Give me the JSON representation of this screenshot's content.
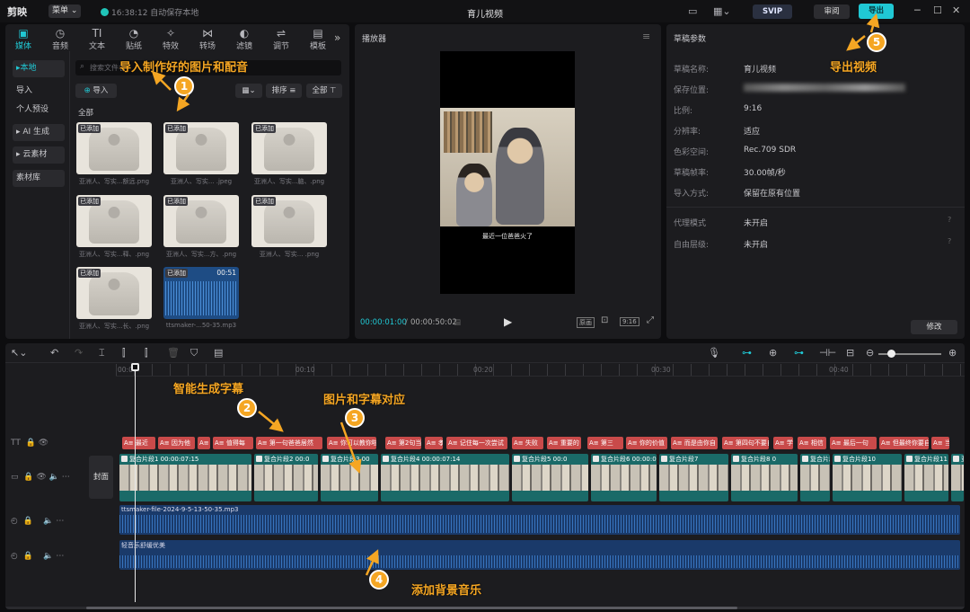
{
  "topbar": {
    "logo": "剪映",
    "menu": "菜单 ⌄",
    "save_status": "16:38:12 自动保存本地",
    "project_title": "育儿视频",
    "svip": "SVIP",
    "review": "审阅",
    "export": "导出"
  },
  "library": {
    "tools": [
      "媒体",
      "音频",
      "文本",
      "贴纸",
      "特效",
      "转场",
      "滤镜",
      "调节",
      "模板"
    ],
    "tool_glyphs": [
      "▣",
      "◷",
      "TI",
      "◔",
      "✧",
      "⋈",
      "◐",
      "⇌",
      "▤"
    ],
    "sidebar": [
      "▸本地",
      "导入",
      "个人预设",
      "▸ AI 生成",
      "▸ 云素材",
      "素材库"
    ],
    "search_placeholder": "搜索文件名",
    "import_btn": "导入",
    "sort_btn": "排序",
    "all_btn": "全部",
    "section": "全部",
    "added_badge": "已添加",
    "items": [
      {
        "caption": "亚洲人、写实...额远.png"
      },
      {
        "caption": "亚洲人、写实...  .jpeg"
      },
      {
        "caption": "亚洲人、写实...脑、.png"
      },
      {
        "caption": "亚洲人、写实...释、.png"
      },
      {
        "caption": "亚洲人、写实...方、.png"
      },
      {
        "caption": "亚洲人、写实...  .png"
      },
      {
        "caption": "亚洲人、写实...长、.png"
      },
      {
        "caption": "ttsmaker-...50-35.mp3",
        "duration": "00:51"
      }
    ]
  },
  "player": {
    "header": "播放器",
    "subtitle": "最近一位爸爸火了",
    "current_time": "00:00:01:00",
    "total_time": "00:00:50:02",
    "original": "原画",
    "ratio": "9:16"
  },
  "params": {
    "header": "草稿参数",
    "rows": [
      {
        "label": "草稿名称:",
        "value": "育儿视频"
      },
      {
        "label": "保存位置:",
        "value": ""
      },
      {
        "label": "比例:",
        "value": "9:16"
      },
      {
        "label": "分辨率:",
        "value": "适应"
      },
      {
        "label": "色彩空间:",
        "value": "Rec.709 SDR"
      },
      {
        "label": "草稿帧率:",
        "value": "30.00帧/秒"
      },
      {
        "label": "导入方式:",
        "value": "保留在原有位置"
      },
      {
        "label": "代理模式",
        "value": "未开启"
      },
      {
        "label": "自由层级:",
        "value": "未开启"
      }
    ],
    "modify": "修改"
  },
  "timeline": {
    "ruler": [
      "00:00",
      "00:10",
      "00:20",
      "00:30",
      "00:40"
    ],
    "cover": "封面",
    "captions": [
      "A≡ 最近",
      "A≡ 因为他",
      "A≡ 太",
      "A≡ 值得每",
      "A≡ 第一句爸爸居然",
      "A≡ 你可以教你啦",
      "A≡ 第2句当",
      "A≡ 孝",
      "A≡ 记住每一次尝试",
      "A≡ 失败",
      "A≡ 重要的",
      "A≡ 第三",
      "A≡ 你的价值",
      "A≡ 而是由你自",
      "A≡ 第四句不要自",
      "A≡ 学",
      "A≡ 相信",
      "A≡ 最后一句",
      "A≡ 但最终你要自",
      "A≡ 当"
    ],
    "clips": [
      {
        "label": "复合片段1  00:00:07:15"
      },
      {
        "label": "复合片段2  00:0"
      },
      {
        "label": "复合片段3  00"
      },
      {
        "label": "复合片段4  00:00:07:14"
      },
      {
        "label": "复合片段5  00:0"
      },
      {
        "label": "复合片段6  00:00:0"
      },
      {
        "label": "复合片段7"
      },
      {
        "label": "复合片段8  0"
      },
      {
        "label": "复合片段9"
      },
      {
        "label": "复合片段10"
      },
      {
        "label": "复合片段11"
      },
      {
        "label": "亚洲"
      }
    ],
    "audio1": "ttsmaker-file-2024-9-5-13-50-35.mp3",
    "audio2": "轻音乐舒缓优美"
  },
  "annotations": {
    "a1": "导入制作好的图片和配音",
    "a2": "智能生成字幕",
    "a3": "图片和字幕对应",
    "a4": "添加背景音乐",
    "a5": "导出视频",
    "n1": "1",
    "n2": "2",
    "n3": "3",
    "n4": "4",
    "n5": "5"
  },
  "colors": {
    "accent": "#20c8d4",
    "annotation": "#f5a623",
    "caption_clip": "#c94a4a",
    "video_track": "#1a6a68",
    "audio_track": "#1a3a6a"
  }
}
